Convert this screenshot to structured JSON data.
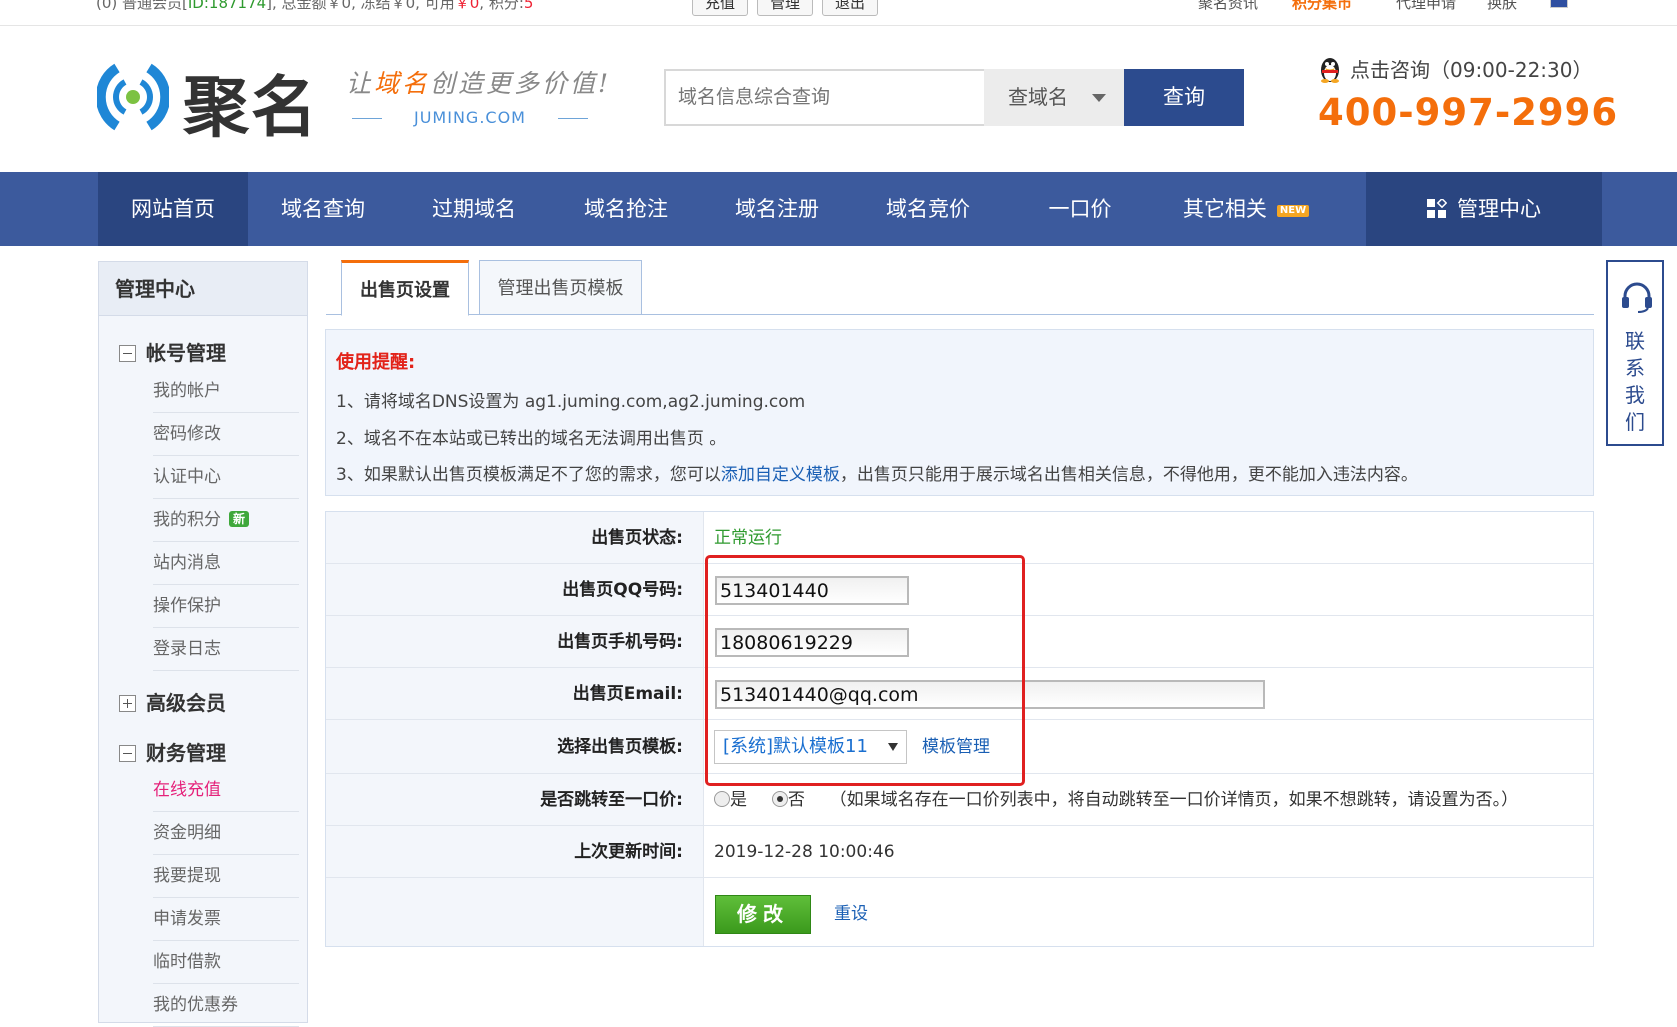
{
  "topbar": {
    "member_info_prefix": "(0) 普通会员[",
    "member_id": "ID:187174",
    "member_info_mid": "], 总金额￥0, 冻结￥0, 可用",
    "available": "￥0",
    "points_label": ", 积分:",
    "points": "5",
    "buttons": [
      "充值",
      "管理",
      "退出"
    ],
    "links": [
      "聚名资讯",
      "积分集市",
      "代理申请",
      "换肤"
    ]
  },
  "header": {
    "brand": "聚名",
    "slogan_pre": "让",
    "slogan_hl": "域名",
    "slogan_post": "创造更多价值!",
    "domain": "JUMING.COM",
    "search_placeholder": "域名信息综合查询",
    "search_type": "查域名",
    "search_button": "查询",
    "consult": "点击咨询（09:00-22:30）",
    "hotline": "400-997-2996"
  },
  "nav": {
    "items": [
      "网站首页",
      "域名查询",
      "过期域名",
      "域名抢注",
      "域名注册",
      "域名竞价",
      "一口价",
      "其它相关"
    ],
    "new_badge": "NEW",
    "management": "管理中心"
  },
  "sidebar": {
    "title": "管理中心",
    "groups": [
      "帐号管理",
      "高级会员",
      "财务管理"
    ],
    "account_items": [
      "我的帐户",
      "密码修改",
      "认证中心",
      "我的积分",
      "站内消息",
      "操作保护",
      "登录日志"
    ],
    "new_badge": "新",
    "finance_items": [
      "在线充值",
      "资金明细",
      "我要提现",
      "申请发票",
      "临时借款",
      "我的优惠券"
    ]
  },
  "tabs": [
    "出售页设置",
    "管理出售页模板"
  ],
  "notice": {
    "title": "使用提醒:",
    "line1": "1、请将域名DNS设置为 ag1.juming.com,ag2.juming.com",
    "line2": "2、域名不在本站或已转出的域名无法调用出售页 。",
    "line3_pre": "3、如果默认出售页模板满足不了您的需求，您可以",
    "line3_link": "添加自定义模板",
    "line3_post": "，出售页只能用于展示域名出售相关信息，不得他用，更不能加入违法内容。"
  },
  "form": {
    "status_label": "出售页状态:",
    "status_value": "正常运行",
    "qq_label": "出售页QQ号码:",
    "qq_value": "513401440",
    "phone_label": "出售页手机号码:",
    "phone_value": "18080619229",
    "email_label": "出售页Email:",
    "email_value": "513401440@qq.com",
    "template_label": "选择出售页模板:",
    "template_value": "[系统]默认模板11",
    "template_manage": "模板管理",
    "redirect_label": "是否跳转至一口价:",
    "redirect_yes": "是",
    "redirect_no": "否",
    "redirect_hint": "（如果域名存在一口价列表中，将自动跳转至一口价详情页，如果不想跳转，请设置为否。）",
    "updated_label": "上次更新时间:",
    "updated_value": "2019-12-28 10:00:46",
    "submit": "修改",
    "reset": "重设"
  },
  "contact": {
    "chars": [
      "联",
      "系",
      "我",
      "们"
    ]
  },
  "colors": {
    "nav_bg": "#3c5a9d",
    "nav_active": "#2a4580",
    "accent_orange": "#f46e0b",
    "highlight_red": "#e02020",
    "submit_green": "#4aaa2a"
  }
}
